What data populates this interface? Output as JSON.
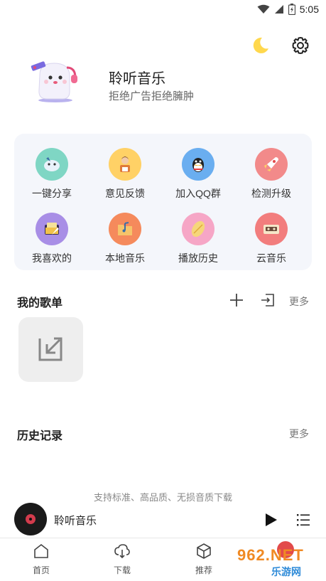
{
  "status_bar": {
    "time": "5:05",
    "icons": [
      "wifi-icon",
      "signal-icon",
      "battery-icon"
    ]
  },
  "header": {
    "app_name": "聆听音乐",
    "tagline": "拒绝广告拒绝臃肿",
    "actions": [
      "moon-icon",
      "gear-icon"
    ]
  },
  "grid": {
    "items": [
      {
        "label": "一键分享",
        "icon": "share-icon",
        "color": "#7fd6c4"
      },
      {
        "label": "意见反馈",
        "icon": "feedback-icon",
        "color": "#ffd166"
      },
      {
        "label": "加入QQ群",
        "icon": "qq-icon",
        "color": "#6aaef0"
      },
      {
        "label": "检测升级",
        "icon": "upgrade-icon",
        "color": "#f28a8a"
      },
      {
        "label": "我喜欢的",
        "icon": "favorite-icon",
        "color": "#a88ee6"
      },
      {
        "label": "本地音乐",
        "icon": "local-music-icon",
        "color": "#f58a5c"
      },
      {
        "label": "播放历史",
        "icon": "history-icon",
        "color": "#f6a6c6"
      },
      {
        "label": "云音乐",
        "icon": "cloud-music-icon",
        "color": "#f27d7d"
      }
    ]
  },
  "playlists": {
    "title": "我的歌单",
    "more": "更多"
  },
  "history": {
    "title": "历史记录",
    "more": "更多"
  },
  "promo": "支持标准、高品质、无损音质下载",
  "player": {
    "title": "聆听音乐"
  },
  "nav": {
    "items": [
      {
        "label": "首页",
        "icon": "home-icon"
      },
      {
        "label": "下载",
        "icon": "download-icon"
      },
      {
        "label": "推荐",
        "icon": "cube-icon"
      }
    ]
  },
  "watermark": {
    "text": "962.NET",
    "sub": "乐游网"
  },
  "colors": {
    "accent": "#e24a4a",
    "card_bg": "#f4f6fb",
    "moon": "#ffd84d"
  }
}
